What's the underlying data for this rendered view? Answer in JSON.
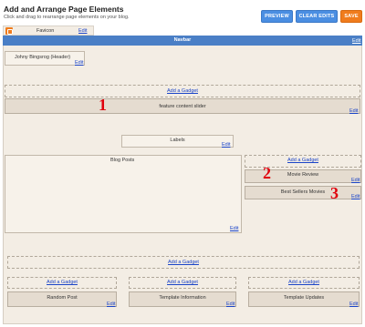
{
  "header": {
    "title": "Add and Arrange Page Elements",
    "subtitle": "Click and drag to rearrange page elements on your blog."
  },
  "buttons": {
    "preview": "PREVIEW",
    "clear_edits": "CLEAR EDITS",
    "save": "SAVE"
  },
  "favicon": {
    "label": "Favicon",
    "edit": "Edit"
  },
  "navbar": {
    "label": "Navbar",
    "edit": "Edit"
  },
  "header_widget": {
    "label": "Johny Bingsrog (Header)",
    "edit": "Edit"
  },
  "top_section": {
    "add_gadget": "Add a Gadget"
  },
  "feature_slider": {
    "label": "feature content slider",
    "edit": "Edit"
  },
  "labels_widget": {
    "label": "Labels",
    "edit": "Edit"
  },
  "blog_posts": {
    "label": "Blog Posts",
    "edit": "Edit"
  },
  "sidebar": {
    "add_gadget": "Add a Gadget",
    "items": [
      {
        "label": "Movie Review",
        "edit": "Edit"
      },
      {
        "label": "Best Sellers Movies",
        "edit": "Edit"
      }
    ]
  },
  "footer": {
    "add_gadget": "Add a Gadget",
    "columns": [
      {
        "add_gadget": "Add a Gadget",
        "label": "Random Post",
        "edit": "Edit"
      },
      {
        "add_gadget": "Add a Gadget",
        "label": "Template Information",
        "edit": "Edit"
      },
      {
        "add_gadget": "Add a Gadget",
        "label": "Template Updates",
        "edit": "Edit"
      }
    ]
  },
  "annotations": [
    "1",
    "2",
    "3"
  ],
  "colors": {
    "button_blue": "#4a8ee2",
    "button_orange": "#f07c1d",
    "navbar_blue": "#4a7fc6",
    "layout_bg": "#f3ede4",
    "annotation_red": "#e0000c"
  }
}
